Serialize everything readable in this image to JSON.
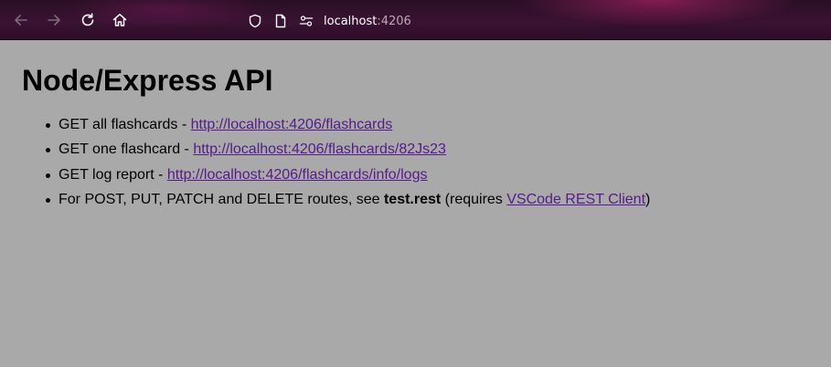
{
  "browser": {
    "url_host": "localhost",
    "url_port": ":4206",
    "icons": [
      "back-arrow-icon",
      "forward-arrow-icon",
      "reload-icon",
      "home-icon",
      "shield-icon",
      "page-icon",
      "permissions-icon"
    ]
  },
  "page": {
    "title": "Node/Express API",
    "items": [
      {
        "prefix": "GET all flashcards - ",
        "link": "http://localhost:4206/flashcards"
      },
      {
        "prefix": "GET one flashcard - ",
        "link": "http://localhost:4206/flashcards/82Js23"
      },
      {
        "prefix": "GET log report - ",
        "link": "http://localhost:4206/flashcards/info/logs"
      }
    ],
    "last_item": {
      "prefix": "For POST, PUT, PATCH and DELETE routes, see ",
      "bold": "test.rest",
      "middle": " (requires ",
      "link": "VSCode REST Client",
      "suffix": ")"
    }
  },
  "colors": {
    "background": "#a9a9a9",
    "link": "#551a8b",
    "toolbar": "#3a1232"
  }
}
